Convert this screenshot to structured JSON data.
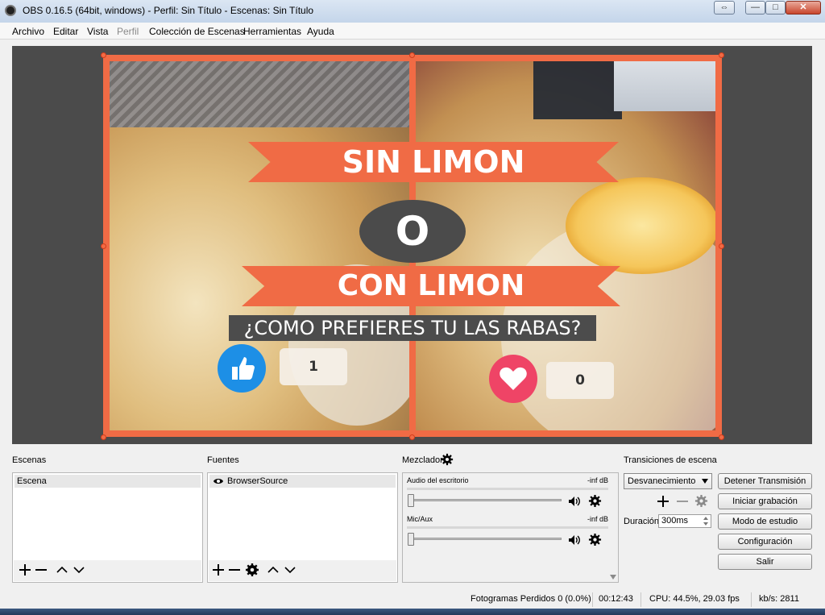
{
  "window": {
    "title": "OBS 0.16.5 (64bit, windows) - Perfil: Sin Título - Escenas: Sin Título",
    "controls": [
      "⇔",
      "—",
      "□",
      "✕"
    ]
  },
  "menu": [
    "Archivo",
    "Editar",
    "Vista",
    "Perfil",
    "Colección de Escenas",
    "Herramientas",
    "Ayuda"
  ],
  "preview": {
    "ribbon_top": "SIN LIMON",
    "middle": "O",
    "ribbon_bottom": "CON LIMON",
    "question": "¿COMO PREFIERES TU LAS RABAS?",
    "like_count": "1",
    "love_count": "0",
    "accent_color": "#f06b45",
    "like_color": "#1d8fe6",
    "love_color": "#ef4466"
  },
  "docks": {
    "scenes": {
      "label": "Escenas",
      "items": [
        "Escena"
      ]
    },
    "sources": {
      "label": "Fuentes",
      "items": [
        "BrowserSource"
      ]
    },
    "mixer": {
      "label": "Mezclador",
      "channels": [
        {
          "name": "Audio del escritorio",
          "level": "-inf dB"
        },
        {
          "name": "Mic/Aux",
          "level": "-inf dB"
        }
      ]
    },
    "transitions": {
      "label": "Transiciones de escena",
      "selected": "Desvanecimiento",
      "duration_label": "Duración",
      "duration_value": "300ms"
    }
  },
  "controls": {
    "stop_stream": "Detener Transmisión",
    "start_recording": "Iniciar grabación",
    "studio_mode": "Modo de estudio",
    "settings": "Configuración",
    "exit": "Salir"
  },
  "status": {
    "dropped_frames": "Fotogramas Perdidos 0 (0.0%)",
    "time": "00:12:43",
    "cpu": "CPU: 44.5%, 29.03 fps",
    "kbps": "kb/s: 2811"
  }
}
